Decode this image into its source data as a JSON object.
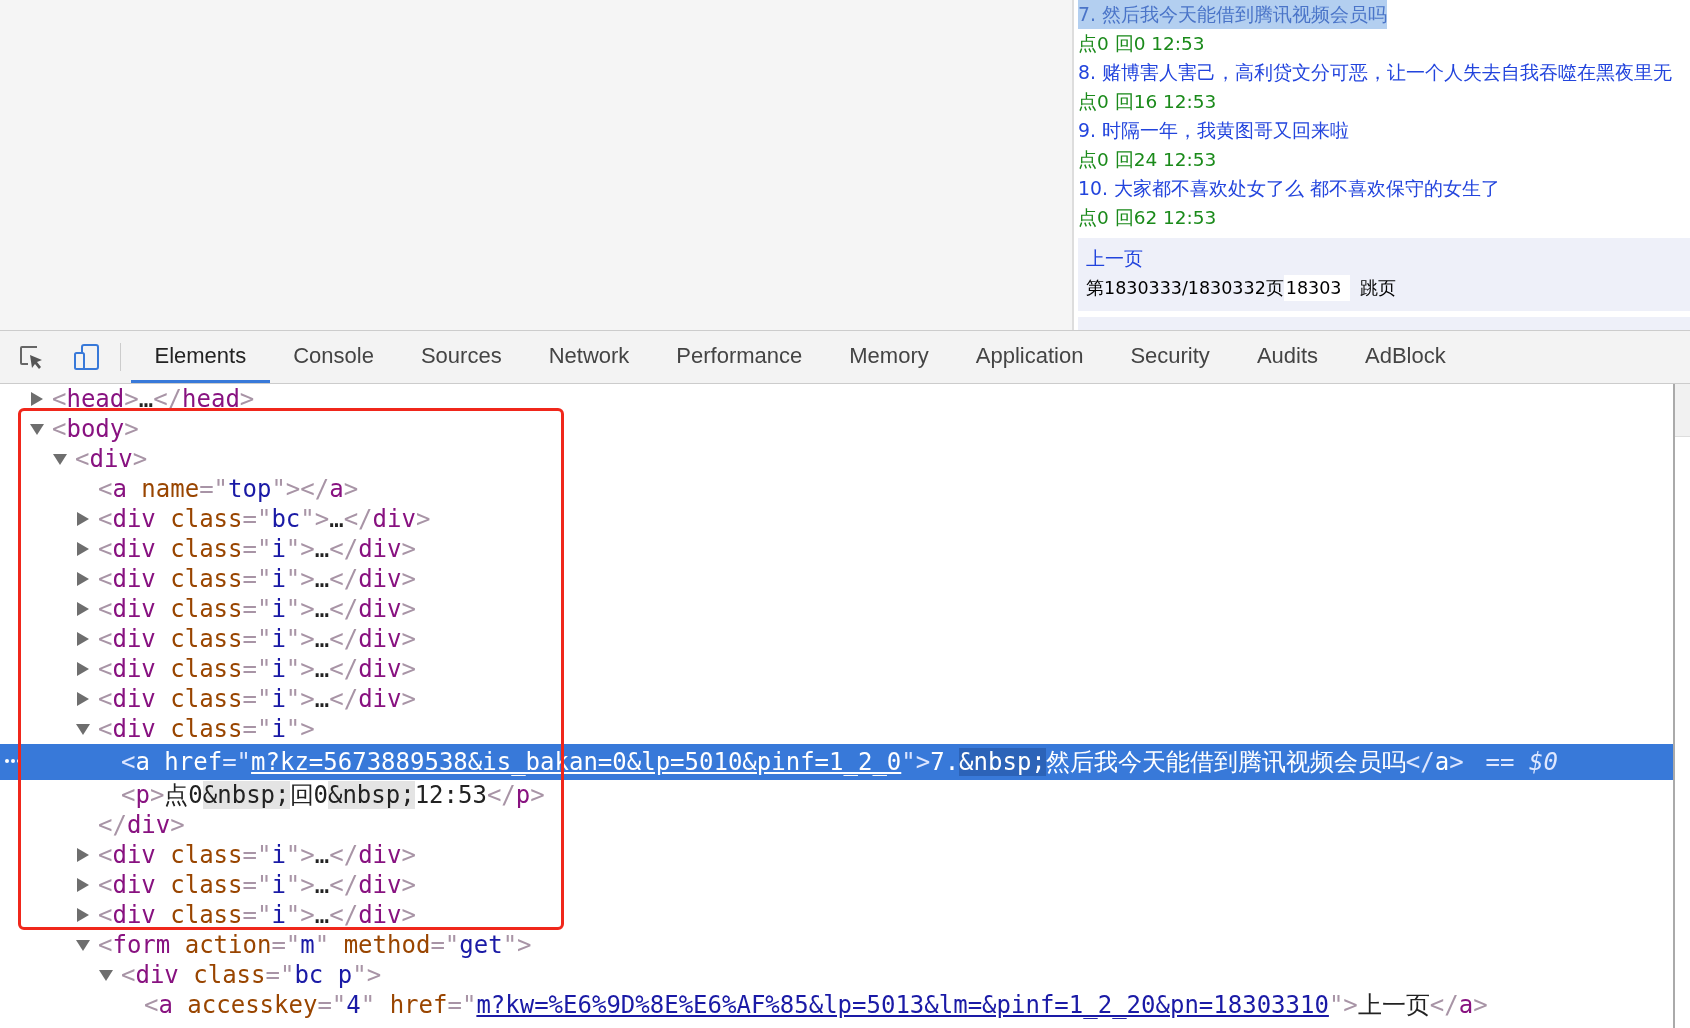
{
  "page": {
    "items": [
      {
        "title": "7. 然后我今天能借到腾讯视频会员吗",
        "meta": "点0 回0 12:53",
        "highlighted": true
      },
      {
        "title": "8. 赌博害人害己，高利贷文分可恶，让一个人失去自我吞噬在黑夜里无",
        "meta": "点0 回16 12:53",
        "highlighted": false
      },
      {
        "title": "9. 时隔一年，我黄图哥又回来啦",
        "meta": "点0 回24 12:53",
        "highlighted": false
      },
      {
        "title": "10. 大家都不喜欢处女了么 都不喜欢保守的女生了",
        "meta": "点0 回62 12:53",
        "highlighted": false
      }
    ],
    "pager": {
      "prev": "上一页",
      "status": "第1830333/1830332页",
      "jump_value": "18303",
      "jump_button": "跳页"
    }
  },
  "devtools": {
    "tabs": [
      {
        "label": "Elements",
        "selected": true
      },
      {
        "label": "Console",
        "selected": false
      },
      {
        "label": "Sources",
        "selected": false
      },
      {
        "label": "Network",
        "selected": false
      },
      {
        "label": "Performance",
        "selected": false
      },
      {
        "label": "Memory",
        "selected": false
      },
      {
        "label": "Application",
        "selected": false
      },
      {
        "label": "Security",
        "selected": false
      },
      {
        "label": "Audits",
        "selected": false
      },
      {
        "label": "AdBlock",
        "selected": false
      }
    ],
    "device_mode_on": true,
    "selected_marker": "== $0",
    "annotation_box": true,
    "tree": [
      {
        "expanded": false,
        "selected": false,
        "parts": [
          {
            "kind": "punct",
            "text": "<"
          },
          {
            "kind": "tag",
            "text": "head"
          },
          {
            "kind": "punct",
            "text": ">"
          },
          {
            "kind": "text",
            "text": "…"
          },
          {
            "kind": "punct",
            "text": "</"
          },
          {
            "kind": "tag",
            "text": "head"
          },
          {
            "kind": "punct",
            "text": ">"
          }
        ]
      },
      {
        "expanded": true,
        "selected": false,
        "parts": [
          {
            "kind": "punct",
            "text": "<"
          },
          {
            "kind": "tag",
            "text": "body"
          },
          {
            "kind": "punct",
            "text": ">"
          }
        ],
        "children": [
          {
            "expanded": true,
            "selected": false,
            "parts": [
              {
                "kind": "punct",
                "text": "<"
              },
              {
                "kind": "tag",
                "text": "div"
              },
              {
                "kind": "punct",
                "text": ">"
              }
            ],
            "children": [
              {
                "selected": false,
                "parts": [
                  {
                    "kind": "punct",
                    "text": "<"
                  },
                  {
                    "kind": "tag",
                    "text": "a "
                  },
                  {
                    "kind": "attr",
                    "text": "name"
                  },
                  {
                    "kind": "punct",
                    "text": "=\""
                  },
                  {
                    "kind": "value",
                    "text": "top"
                  },
                  {
                    "kind": "punct",
                    "text": "\">"
                  },
                  {
                    "kind": "punct",
                    "text": "</"
                  },
                  {
                    "kind": "tag",
                    "text": "a"
                  },
                  {
                    "kind": "punct",
                    "text": ">"
                  }
                ]
              },
              {
                "expanded": false,
                "selected": false,
                "parts": [
                  {
                    "kind": "punct",
                    "text": "<"
                  },
                  {
                    "kind": "tag",
                    "text": "div "
                  },
                  {
                    "kind": "attr",
                    "text": "class"
                  },
                  {
                    "kind": "punct",
                    "text": "=\""
                  },
                  {
                    "kind": "value",
                    "text": "bc"
                  },
                  {
                    "kind": "punct",
                    "text": "\">"
                  },
                  {
                    "kind": "text",
                    "text": "…"
                  },
                  {
                    "kind": "punct",
                    "text": "</"
                  },
                  {
                    "kind": "tag",
                    "text": "div"
                  },
                  {
                    "kind": "punct",
                    "text": ">"
                  }
                ]
              },
              {
                "expanded": false,
                "selected": false,
                "parts": [
                  {
                    "kind": "punct",
                    "text": "<"
                  },
                  {
                    "kind": "tag",
                    "text": "div "
                  },
                  {
                    "kind": "attr",
                    "text": "class"
                  },
                  {
                    "kind": "punct",
                    "text": "=\""
                  },
                  {
                    "kind": "value",
                    "text": "i"
                  },
                  {
                    "kind": "punct",
                    "text": "\">"
                  },
                  {
                    "kind": "text",
                    "text": "…"
                  },
                  {
                    "kind": "punct",
                    "text": "</"
                  },
                  {
                    "kind": "tag",
                    "text": "div"
                  },
                  {
                    "kind": "punct",
                    "text": ">"
                  }
                ]
              },
              {
                "expanded": false,
                "selected": false,
                "parts": [
                  {
                    "kind": "punct",
                    "text": "<"
                  },
                  {
                    "kind": "tag",
                    "text": "div "
                  },
                  {
                    "kind": "attr",
                    "text": "class"
                  },
                  {
                    "kind": "punct",
                    "text": "=\""
                  },
                  {
                    "kind": "value",
                    "text": "i"
                  },
                  {
                    "kind": "punct",
                    "text": "\">"
                  },
                  {
                    "kind": "text",
                    "text": "…"
                  },
                  {
                    "kind": "punct",
                    "text": "</"
                  },
                  {
                    "kind": "tag",
                    "text": "div"
                  },
                  {
                    "kind": "punct",
                    "text": ">"
                  }
                ]
              },
              {
                "expanded": false,
                "selected": false,
                "parts": [
                  {
                    "kind": "punct",
                    "text": "<"
                  },
                  {
                    "kind": "tag",
                    "text": "div "
                  },
                  {
                    "kind": "attr",
                    "text": "class"
                  },
                  {
                    "kind": "punct",
                    "text": "=\""
                  },
                  {
                    "kind": "value",
                    "text": "i"
                  },
                  {
                    "kind": "punct",
                    "text": "\">"
                  },
                  {
                    "kind": "text",
                    "text": "…"
                  },
                  {
                    "kind": "punct",
                    "text": "</"
                  },
                  {
                    "kind": "tag",
                    "text": "div"
                  },
                  {
                    "kind": "punct",
                    "text": ">"
                  }
                ]
              },
              {
                "expanded": false,
                "selected": false,
                "parts": [
                  {
                    "kind": "punct",
                    "text": "<"
                  },
                  {
                    "kind": "tag",
                    "text": "div "
                  },
                  {
                    "kind": "attr",
                    "text": "class"
                  },
                  {
                    "kind": "punct",
                    "text": "=\""
                  },
                  {
                    "kind": "value",
                    "text": "i"
                  },
                  {
                    "kind": "punct",
                    "text": "\">"
                  },
                  {
                    "kind": "text",
                    "text": "…"
                  },
                  {
                    "kind": "punct",
                    "text": "</"
                  },
                  {
                    "kind": "tag",
                    "text": "div"
                  },
                  {
                    "kind": "punct",
                    "text": ">"
                  }
                ]
              },
              {
                "expanded": false,
                "selected": false,
                "parts": [
                  {
                    "kind": "punct",
                    "text": "<"
                  },
                  {
                    "kind": "tag",
                    "text": "div "
                  },
                  {
                    "kind": "attr",
                    "text": "class"
                  },
                  {
                    "kind": "punct",
                    "text": "=\""
                  },
                  {
                    "kind": "value",
                    "text": "i"
                  },
                  {
                    "kind": "punct",
                    "text": "\">"
                  },
                  {
                    "kind": "text",
                    "text": "…"
                  },
                  {
                    "kind": "punct",
                    "text": "</"
                  },
                  {
                    "kind": "tag",
                    "text": "div"
                  },
                  {
                    "kind": "punct",
                    "text": ">"
                  }
                ]
              },
              {
                "expanded": false,
                "selected": false,
                "parts": [
                  {
                    "kind": "punct",
                    "text": "<"
                  },
                  {
                    "kind": "tag",
                    "text": "div "
                  },
                  {
                    "kind": "attr",
                    "text": "class"
                  },
                  {
                    "kind": "punct",
                    "text": "=\""
                  },
                  {
                    "kind": "value",
                    "text": "i"
                  },
                  {
                    "kind": "punct",
                    "text": "\">"
                  },
                  {
                    "kind": "text",
                    "text": "…"
                  },
                  {
                    "kind": "punct",
                    "text": "</"
                  },
                  {
                    "kind": "tag",
                    "text": "div"
                  },
                  {
                    "kind": "punct",
                    "text": ">"
                  }
                ]
              },
              {
                "expanded": true,
                "selected": false,
                "parts": [
                  {
                    "kind": "punct",
                    "text": "<"
                  },
                  {
                    "kind": "tag",
                    "text": "div "
                  },
                  {
                    "kind": "attr",
                    "text": "class"
                  },
                  {
                    "kind": "punct",
                    "text": "=\""
                  },
                  {
                    "kind": "value",
                    "text": "i"
                  },
                  {
                    "kind": "punct",
                    "text": "\">"
                  }
                ],
                "close": [
                  {
                    "kind": "punct",
                    "text": "</"
                  },
                  {
                    "kind": "tag",
                    "text": "div"
                  },
                  {
                    "kind": "punct",
                    "text": ">"
                  }
                ],
                "children": [
                  {
                    "selected": true,
                    "parts": [
                      {
                        "kind": "punct",
                        "text": "<"
                      },
                      {
                        "kind": "tag",
                        "text": "a "
                      },
                      {
                        "kind": "attr",
                        "text": "href"
                      },
                      {
                        "kind": "punct",
                        "text": "=\""
                      },
                      {
                        "kind": "link",
                        "text": "m?kz=5673889538&is_bakan=0&lp=5010&pinf=1_2_0"
                      },
                      {
                        "kind": "punct",
                        "text": "\">"
                      },
                      {
                        "kind": "text",
                        "text": "7."
                      },
                      {
                        "kind": "entity",
                        "text": "&nbsp;"
                      },
                      {
                        "kind": "text",
                        "text": "然后我今天能借到腾讯视频会员吗"
                      },
                      {
                        "kind": "punct",
                        "text": "</"
                      },
                      {
                        "kind": "tag",
                        "text": "a"
                      },
                      {
                        "kind": "punct",
                        "text": ">"
                      }
                    ]
                  },
                  {
                    "selected": false,
                    "parts": [
                      {
                        "kind": "punct",
                        "text": "<"
                      },
                      {
                        "kind": "tag",
                        "text": "p"
                      },
                      {
                        "kind": "punct",
                        "text": ">"
                      },
                      {
                        "kind": "text",
                        "text": "点0"
                      },
                      {
                        "kind": "entity",
                        "text": "&nbsp;"
                      },
                      {
                        "kind": "text",
                        "text": "回0"
                      },
                      {
                        "kind": "entity",
                        "text": "&nbsp;"
                      },
                      {
                        "kind": "text",
                        "text": "12:53"
                      },
                      {
                        "kind": "punct",
                        "text": "</"
                      },
                      {
                        "kind": "tag",
                        "text": "p"
                      },
                      {
                        "kind": "punct",
                        "text": ">"
                      }
                    ]
                  }
                ]
              },
              {
                "expanded": false,
                "selected": false,
                "parts": [
                  {
                    "kind": "punct",
                    "text": "<"
                  },
                  {
                    "kind": "tag",
                    "text": "div "
                  },
                  {
                    "kind": "attr",
                    "text": "class"
                  },
                  {
                    "kind": "punct",
                    "text": "=\""
                  },
                  {
                    "kind": "value",
                    "text": "i"
                  },
                  {
                    "kind": "punct",
                    "text": "\">"
                  },
                  {
                    "kind": "text",
                    "text": "…"
                  },
                  {
                    "kind": "punct",
                    "text": "</"
                  },
                  {
                    "kind": "tag",
                    "text": "div"
                  },
                  {
                    "kind": "punct",
                    "text": ">"
                  }
                ]
              },
              {
                "expanded": false,
                "selected": false,
                "parts": [
                  {
                    "kind": "punct",
                    "text": "<"
                  },
                  {
                    "kind": "tag",
                    "text": "div "
                  },
                  {
                    "kind": "attr",
                    "text": "class"
                  },
                  {
                    "kind": "punct",
                    "text": "=\""
                  },
                  {
                    "kind": "value",
                    "text": "i"
                  },
                  {
                    "kind": "punct",
                    "text": "\">"
                  },
                  {
                    "kind": "text",
                    "text": "…"
                  },
                  {
                    "kind": "punct",
                    "text": "</"
                  },
                  {
                    "kind": "tag",
                    "text": "div"
                  },
                  {
                    "kind": "punct",
                    "text": ">"
                  }
                ]
              },
              {
                "expanded": false,
                "selected": false,
                "parts": [
                  {
                    "kind": "punct",
                    "text": "<"
                  },
                  {
                    "kind": "tag",
                    "text": "div "
                  },
                  {
                    "kind": "attr",
                    "text": "class"
                  },
                  {
                    "kind": "punct",
                    "text": "=\""
                  },
                  {
                    "kind": "value",
                    "text": "i"
                  },
                  {
                    "kind": "punct",
                    "text": "\">"
                  },
                  {
                    "kind": "text",
                    "text": "…"
                  },
                  {
                    "kind": "punct",
                    "text": "</"
                  },
                  {
                    "kind": "tag",
                    "text": "div"
                  },
                  {
                    "kind": "punct",
                    "text": ">"
                  }
                ]
              },
              {
                "expanded": true,
                "selected": false,
                "parts": [
                  {
                    "kind": "punct",
                    "text": "<"
                  },
                  {
                    "kind": "tag",
                    "text": "form "
                  },
                  {
                    "kind": "attr",
                    "text": "action"
                  },
                  {
                    "kind": "punct",
                    "text": "=\""
                  },
                  {
                    "kind": "value",
                    "text": "m"
                  },
                  {
                    "kind": "punct",
                    "text": "\" "
                  },
                  {
                    "kind": "attr",
                    "text": "method"
                  },
                  {
                    "kind": "punct",
                    "text": "=\""
                  },
                  {
                    "kind": "value",
                    "text": "get"
                  },
                  {
                    "kind": "punct",
                    "text": "\">"
                  }
                ],
                "children": [
                  {
                    "expanded": true,
                    "selected": false,
                    "parts": [
                      {
                        "kind": "punct",
                        "text": "<"
                      },
                      {
                        "kind": "tag",
                        "text": "div "
                      },
                      {
                        "kind": "attr",
                        "text": "class"
                      },
                      {
                        "kind": "punct",
                        "text": "=\""
                      },
                      {
                        "kind": "value",
                        "text": "bc p"
                      },
                      {
                        "kind": "punct",
                        "text": "\">"
                      }
                    ],
                    "children": [
                      {
                        "selected": false,
                        "parts": [
                          {
                            "kind": "punct",
                            "text": "<"
                          },
                          {
                            "kind": "tag",
                            "text": "a "
                          },
                          {
                            "kind": "attr",
                            "text": "accesskey"
                          },
                          {
                            "kind": "punct",
                            "text": "=\""
                          },
                          {
                            "kind": "value",
                            "text": "4"
                          },
                          {
                            "kind": "punct",
                            "text": "\" "
                          },
                          {
                            "kind": "attr",
                            "text": "href"
                          },
                          {
                            "kind": "punct",
                            "text": "=\""
                          },
                          {
                            "kind": "link",
                            "text": "m?kw=%E6%9D%8E%E6%AF%85&lp=5013&lm=&pinf=1_2_20&pn=18303310"
                          },
                          {
                            "kind": "punct",
                            "text": "\">"
                          },
                          {
                            "kind": "text",
                            "text": "上一页"
                          },
                          {
                            "kind": "punct",
                            "text": "</"
                          },
                          {
                            "kind": "tag",
                            "text": "a"
                          },
                          {
                            "kind": "punct",
                            "text": ">"
                          }
                        ]
                      }
                    ]
                  }
                ]
              }
            ]
          }
        ]
      }
    ]
  }
}
